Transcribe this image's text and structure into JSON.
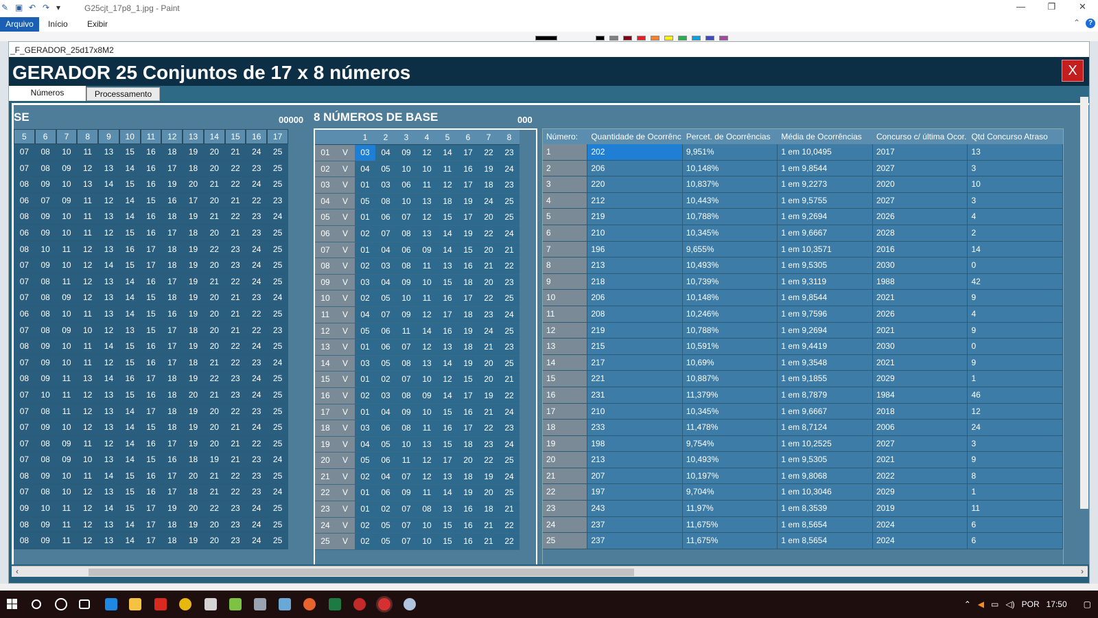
{
  "paint": {
    "title": "G25cjt_17p8_1.jpg - Paint",
    "tabs": {
      "file": "Arquivo",
      "home": "Início",
      "view": "Exibir"
    },
    "colors": [
      "#000000",
      "#7f7f7f",
      "#880015",
      "#ed1c24",
      "#ff7f27",
      "#fff200",
      "#22b14c",
      "#00a2e8",
      "#3f48cc",
      "#a349a4"
    ]
  },
  "form": {
    "caption": "_F_GERADOR_25d17x8M2",
    "header": "GERADOR 25 Conjuntos de 17 x 8 números",
    "close_label": "X",
    "tabs": {
      "numeros": "Números",
      "processamento": "Processamento"
    },
    "labels": {
      "se": "SE",
      "num1": "00000",
      "base": "8 NÚMEROS DE BASE",
      "num2": "000"
    }
  },
  "grid1": {
    "headers": [
      "5",
      "6",
      "7",
      "8",
      "9",
      "10",
      "11",
      "12",
      "13",
      "14",
      "15",
      "16",
      "17"
    ],
    "rows": [
      [
        "07",
        "08",
        "10",
        "11",
        "13",
        "15",
        "16",
        "18",
        "19",
        "20",
        "21",
        "24",
        "25"
      ],
      [
        "07",
        "08",
        "09",
        "12",
        "13",
        "14",
        "16",
        "17",
        "18",
        "20",
        "22",
        "23",
        "25"
      ],
      [
        "08",
        "09",
        "10",
        "13",
        "14",
        "15",
        "16",
        "19",
        "20",
        "21",
        "22",
        "24",
        "25"
      ],
      [
        "06",
        "07",
        "09",
        "11",
        "12",
        "14",
        "15",
        "16",
        "17",
        "20",
        "21",
        "22",
        "23"
      ],
      [
        "08",
        "09",
        "10",
        "11",
        "13",
        "14",
        "16",
        "18",
        "19",
        "21",
        "22",
        "23",
        "24"
      ],
      [
        "06",
        "09",
        "10",
        "11",
        "12",
        "15",
        "16",
        "17",
        "18",
        "20",
        "21",
        "23",
        "25"
      ],
      [
        "08",
        "10",
        "11",
        "12",
        "13",
        "16",
        "17",
        "18",
        "19",
        "22",
        "23",
        "24",
        "25"
      ],
      [
        "07",
        "09",
        "10",
        "12",
        "14",
        "15",
        "17",
        "18",
        "19",
        "20",
        "23",
        "24",
        "25"
      ],
      [
        "07",
        "08",
        "11",
        "12",
        "13",
        "14",
        "16",
        "17",
        "19",
        "21",
        "22",
        "24",
        "25"
      ],
      [
        "07",
        "08",
        "09",
        "12",
        "13",
        "14",
        "15",
        "18",
        "19",
        "20",
        "21",
        "23",
        "24"
      ],
      [
        "06",
        "08",
        "10",
        "11",
        "13",
        "14",
        "15",
        "16",
        "19",
        "20",
        "21",
        "22",
        "25"
      ],
      [
        "07",
        "08",
        "09",
        "10",
        "12",
        "13",
        "15",
        "17",
        "18",
        "20",
        "21",
        "22",
        "23"
      ],
      [
        "08",
        "09",
        "10",
        "11",
        "14",
        "15",
        "16",
        "17",
        "19",
        "20",
        "22",
        "24",
        "25"
      ],
      [
        "07",
        "09",
        "10",
        "11",
        "12",
        "15",
        "16",
        "17",
        "18",
        "21",
        "22",
        "23",
        "24"
      ],
      [
        "08",
        "09",
        "11",
        "13",
        "14",
        "16",
        "17",
        "18",
        "19",
        "22",
        "23",
        "24",
        "25"
      ],
      [
        "07",
        "10",
        "11",
        "12",
        "13",
        "15",
        "16",
        "18",
        "20",
        "21",
        "23",
        "24",
        "25"
      ],
      [
        "07",
        "08",
        "11",
        "12",
        "13",
        "14",
        "17",
        "18",
        "19",
        "20",
        "22",
        "23",
        "25"
      ],
      [
        "07",
        "09",
        "10",
        "12",
        "13",
        "14",
        "15",
        "18",
        "19",
        "20",
        "21",
        "24",
        "25"
      ],
      [
        "07",
        "08",
        "09",
        "11",
        "12",
        "14",
        "16",
        "17",
        "19",
        "20",
        "21",
        "22",
        "25"
      ],
      [
        "07",
        "08",
        "09",
        "10",
        "13",
        "14",
        "15",
        "16",
        "18",
        "19",
        "21",
        "23",
        "24"
      ],
      [
        "08",
        "09",
        "10",
        "11",
        "14",
        "15",
        "16",
        "17",
        "20",
        "21",
        "22",
        "23",
        "25"
      ],
      [
        "07",
        "08",
        "10",
        "12",
        "13",
        "15",
        "16",
        "17",
        "18",
        "21",
        "22",
        "23",
        "24"
      ],
      [
        "09",
        "10",
        "11",
        "12",
        "14",
        "15",
        "17",
        "19",
        "20",
        "22",
        "23",
        "24",
        "25"
      ],
      [
        "08",
        "09",
        "11",
        "12",
        "13",
        "14",
        "17",
        "18",
        "19",
        "20",
        "23",
        "24",
        "25"
      ],
      [
        "08",
        "09",
        "11",
        "12",
        "13",
        "14",
        "17",
        "18",
        "19",
        "20",
        "23",
        "24",
        "25"
      ]
    ]
  },
  "grid2": {
    "headers": [
      "",
      "",
      "1",
      "2",
      "3",
      "4",
      "5",
      "6",
      "7",
      "8"
    ],
    "rows": [
      [
        "01",
        "V",
        "03",
        "04",
        "09",
        "12",
        "14",
        "17",
        "22",
        "23"
      ],
      [
        "02",
        "V",
        "04",
        "05",
        "10",
        "10",
        "11",
        "16",
        "19",
        "24"
      ],
      [
        "03",
        "V",
        "01",
        "03",
        "06",
        "11",
        "12",
        "17",
        "18",
        "23"
      ],
      [
        "04",
        "V",
        "05",
        "08",
        "10",
        "13",
        "18",
        "19",
        "24",
        "25"
      ],
      [
        "05",
        "V",
        "01",
        "06",
        "07",
        "12",
        "15",
        "17",
        "20",
        "25"
      ],
      [
        "06",
        "V",
        "02",
        "07",
        "08",
        "13",
        "14",
        "19",
        "22",
        "24"
      ],
      [
        "07",
        "V",
        "01",
        "04",
        "06",
        "09",
        "14",
        "15",
        "20",
        "21"
      ],
      [
        "08",
        "V",
        "02",
        "03",
        "08",
        "11",
        "13",
        "16",
        "21",
        "22"
      ],
      [
        "09",
        "V",
        "03",
        "04",
        "09",
        "10",
        "15",
        "18",
        "20",
        "23"
      ],
      [
        "10",
        "V",
        "02",
        "05",
        "10",
        "11",
        "16",
        "17",
        "22",
        "25"
      ],
      [
        "11",
        "V",
        "04",
        "07",
        "09",
        "12",
        "17",
        "18",
        "23",
        "24"
      ],
      [
        "12",
        "V",
        "05",
        "06",
        "11",
        "14",
        "16",
        "19",
        "24",
        "25"
      ],
      [
        "13",
        "V",
        "01",
        "06",
        "07",
        "12",
        "13",
        "18",
        "21",
        "23"
      ],
      [
        "14",
        "V",
        "03",
        "05",
        "08",
        "13",
        "14",
        "19",
        "20",
        "25"
      ],
      [
        "15",
        "V",
        "01",
        "02",
        "07",
        "10",
        "12",
        "15",
        "20",
        "21"
      ],
      [
        "16",
        "V",
        "02",
        "03",
        "08",
        "09",
        "14",
        "17",
        "19",
        "22"
      ],
      [
        "17",
        "V",
        "01",
        "04",
        "09",
        "10",
        "15",
        "16",
        "21",
        "24"
      ],
      [
        "18",
        "V",
        "03",
        "06",
        "08",
        "11",
        "16",
        "17",
        "22",
        "23"
      ],
      [
        "19",
        "V",
        "04",
        "05",
        "10",
        "13",
        "15",
        "18",
        "23",
        "24"
      ],
      [
        "20",
        "V",
        "05",
        "06",
        "11",
        "12",
        "17",
        "20",
        "22",
        "25"
      ],
      [
        "21",
        "V",
        "02",
        "04",
        "07",
        "12",
        "13",
        "18",
        "19",
        "24"
      ],
      [
        "22",
        "V",
        "01",
        "06",
        "09",
        "11",
        "14",
        "19",
        "20",
        "25"
      ],
      [
        "23",
        "V",
        "01",
        "02",
        "07",
        "08",
        "13",
        "16",
        "18",
        "21"
      ],
      [
        "24",
        "V",
        "02",
        "05",
        "07",
        "10",
        "15",
        "16",
        "21",
        "22"
      ],
      [
        "25",
        "V",
        "02",
        "05",
        "07",
        "10",
        "15",
        "16",
        "21",
        "22"
      ]
    ]
  },
  "grid3": {
    "headers": [
      "Número:",
      "Quantidade de Ocorrênc",
      "Percet. de Ocorrências",
      "Média de Ocorrências",
      "Concurso c/ última Ocor.",
      "Qtd Concurso Atraso"
    ],
    "rows": [
      [
        "1",
        "202",
        "9,951%",
        "1 em 10,0495",
        "2017",
        "13"
      ],
      [
        "2",
        "206",
        "10,148%",
        "1 em 9,8544",
        "2027",
        "3"
      ],
      [
        "3",
        "220",
        "10,837%",
        "1 em 9,2273",
        "2020",
        "10"
      ],
      [
        "4",
        "212",
        "10,443%",
        "1 em 9,5755",
        "2027",
        "3"
      ],
      [
        "5",
        "219",
        "10,788%",
        "1 em 9,2694",
        "2026",
        "4"
      ],
      [
        "6",
        "210",
        "10,345%",
        "1 em 9,6667",
        "2028",
        "2"
      ],
      [
        "7",
        "196",
        "9,655%",
        "1 em 10,3571",
        "2016",
        "14"
      ],
      [
        "8",
        "213",
        "10,493%",
        "1 em 9,5305",
        "2030",
        "0"
      ],
      [
        "9",
        "218",
        "10,739%",
        "1 em 9,3119",
        "1988",
        "42"
      ],
      [
        "10",
        "206",
        "10,148%",
        "1 em 9,8544",
        "2021",
        "9"
      ],
      [
        "11",
        "208",
        "10,246%",
        "1 em 9,7596",
        "2026",
        "4"
      ],
      [
        "12",
        "219",
        "10,788%",
        "1 em 9,2694",
        "2021",
        "9"
      ],
      [
        "13",
        "215",
        "10,591%",
        "1 em 9,4419",
        "2030",
        "0"
      ],
      [
        "14",
        "217",
        "10,69%",
        "1 em 9,3548",
        "2021",
        "9"
      ],
      [
        "15",
        "221",
        "10,887%",
        "1 em 9,1855",
        "2029",
        "1"
      ],
      [
        "16",
        "231",
        "11,379%",
        "1 em 8,7879",
        "1984",
        "46"
      ],
      [
        "17",
        "210",
        "10,345%",
        "1 em 9,6667",
        "2018",
        "12"
      ],
      [
        "18",
        "233",
        "11,478%",
        "1 em 8,7124",
        "2006",
        "24"
      ],
      [
        "19",
        "198",
        "9,754%",
        "1 em 10,2525",
        "2027",
        "3"
      ],
      [
        "20",
        "213",
        "10,493%",
        "1 em 9,5305",
        "2021",
        "9"
      ],
      [
        "21",
        "207",
        "10,197%",
        "1 em 9,8068",
        "2022",
        "8"
      ],
      [
        "22",
        "197",
        "9,704%",
        "1 em 10,3046",
        "2029",
        "1"
      ],
      [
        "23",
        "243",
        "11,97%",
        "1 em 8,3539",
        "2019",
        "11"
      ],
      [
        "24",
        "237",
        "11,675%",
        "1 em 8,5654",
        "2024",
        "6"
      ],
      [
        "25",
        "237",
        "11,675%",
        "1 em 8,5654",
        "2024",
        "6"
      ]
    ]
  },
  "taskbar": {
    "language": "POR",
    "time": "17:50",
    "icons": [
      "search-icon",
      "cortana-icon",
      "task-view-icon",
      "edge-icon",
      "explorer-icon",
      "acrobat-icon",
      "chrome-icon",
      "store-icon",
      "app-icon",
      "app2-icon",
      "app3-icon",
      "excel-icon",
      "app4-icon",
      "app5-icon",
      "paint-icon"
    ]
  }
}
